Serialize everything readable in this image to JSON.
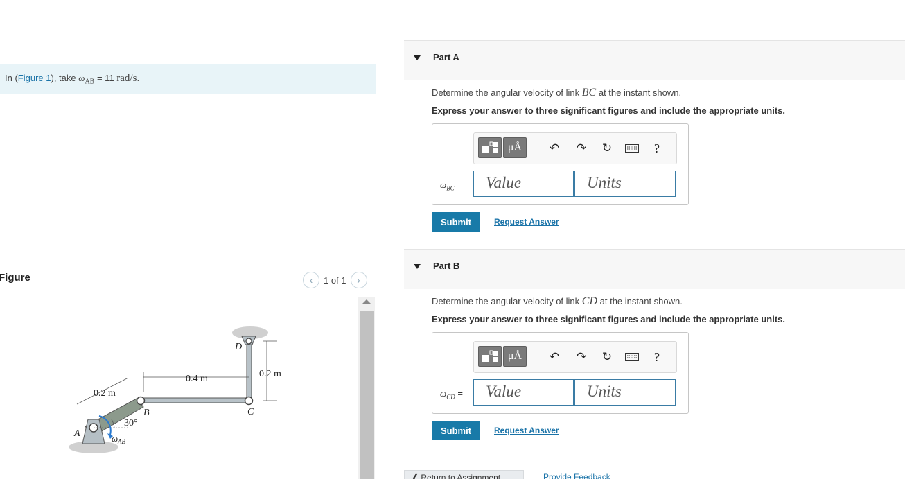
{
  "problem": {
    "prefix": "In (",
    "figure_link": "Figure 1",
    "mid": "), take ",
    "omega": "ω",
    "omega_sub": "AB",
    "equals": " = 11 ",
    "unit": "rad/s",
    "suffix": "."
  },
  "figure_panel": {
    "title": "Figure",
    "pager_text": "1 of 1",
    "prev_icon": "chevron-left",
    "next_icon": "chevron-right"
  },
  "figure_labels": {
    "d": "D",
    "dim_02_top": "0.2 m",
    "dim_04": "0.4 m",
    "dim_02_left": "0.2 m",
    "b": "B",
    "c": "C",
    "a": "A",
    "angle": "30°",
    "omega_ab": "ω",
    "omega_ab_sub": "AB"
  },
  "parts": [
    {
      "title": "Part A",
      "question_prefix": "Determine the angular velocity of link ",
      "question_link": "BC",
      "question_suffix": " at the instant shown.",
      "instruction": "Express your answer to three significant figures and include the appropriate units.",
      "var": "ω",
      "var_sub": "BC",
      "var_eq": " =",
      "value_placeholder": "Value",
      "units_placeholder": "Units",
      "submit_label": "Submit",
      "request_label": "Request Answer"
    },
    {
      "title": "Part B",
      "question_prefix": "Determine the angular velocity of link ",
      "question_link": "CD",
      "question_suffix": " at the instant shown.",
      "instruction": "Express your answer to three significant figures and include the appropriate units.",
      "var": "ω",
      "var_sub": "CD",
      "var_eq": " =",
      "value_placeholder": "Value",
      "units_placeholder": "Units",
      "submit_label": "Submit",
      "request_label": "Request Answer"
    }
  ],
  "toolbar": {
    "templates_icon": "fraction-template-icon",
    "units_label": "μÅ",
    "undo_icon": "undo-icon",
    "redo_icon": "redo-icon",
    "reset_icon": "reset-icon",
    "keyboard_icon": "keyboard-icon",
    "help_label": "?"
  },
  "footer": {
    "return_label": "❮ Return to Assignment",
    "feedback_label": "Provide Feedback"
  }
}
